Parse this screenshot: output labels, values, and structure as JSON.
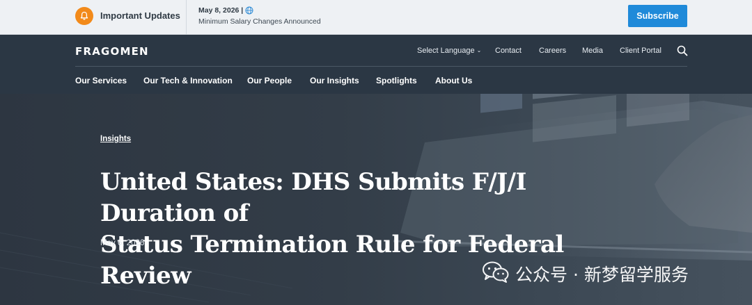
{
  "topbar": {
    "bell_icon": "bell-icon",
    "updates_label": "Important Updates",
    "update_date": "May 8, 2026 |",
    "update_text": "Minimum Salary Changes Announced",
    "subscribe_label": "Subscribe",
    "accent_color": "#f28a1a",
    "subscribe_color": "#1f8ad9"
  },
  "header": {
    "logo": "FRAGOMEN",
    "utility_nav": [
      {
        "label": "Select Language"
      },
      {
        "label": "Contact"
      },
      {
        "label": "Careers"
      },
      {
        "label": "Media"
      },
      {
        "label": "Client Portal"
      }
    ],
    "search_icon": "search-icon",
    "main_nav": [
      {
        "label": "Our Services"
      },
      {
        "label": "Our Tech & Innovation"
      },
      {
        "label": "Our People"
      },
      {
        "label": "Our Insights"
      },
      {
        "label": "Spotlights"
      },
      {
        "label": "About Us"
      }
    ]
  },
  "hero": {
    "breadcrumb": "Insights",
    "title_line1": "United States: DHS Submits F/J/I Duration of",
    "title_line2": "Status Termination Rule for Federal Review",
    "date": "May 6, 2026"
  },
  "watermark": {
    "icon": "wechat-icon",
    "text": "公众号 · 新梦留学服务"
  }
}
